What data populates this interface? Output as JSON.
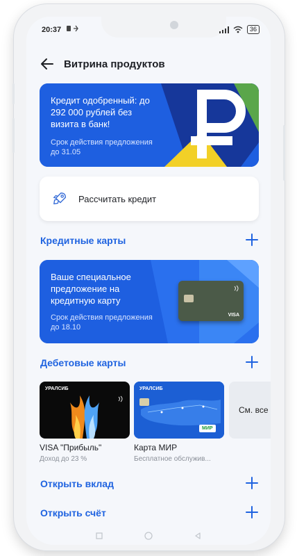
{
  "status_bar": {
    "time": "20:37",
    "battery": "36"
  },
  "header": {
    "title": "Витрина продуктов"
  },
  "promo_credit": {
    "title": "Кредит одобренный: до 292 000 рублей без визита в банк!",
    "subtitle": "Срок действия предложения до 31.05"
  },
  "calc": {
    "label": "Рассчитать кредит"
  },
  "sections": {
    "credit_cards": "Кредитные карты",
    "debit_cards": "Дебетовые карты",
    "deposit": "Открыть вклад",
    "account": "Открыть счёт"
  },
  "promo_card": {
    "title": "Ваше специальное предложение на кредитную карту",
    "subtitle": "Срок действия предложения до 18.10"
  },
  "debit_cards": [
    {
      "name": "VISA \"Прибыль\"",
      "sub": "Доход до 23 %",
      "brand": "УРАЛСИБ"
    },
    {
      "name": "Карта МИР",
      "sub": "Бесплатное обслужив...",
      "brand": "УРАЛСИБ",
      "badge": "МИР"
    }
  ],
  "see_all": "См. все",
  "card_brand": "VISA",
  "colors": {
    "accent": "#1f63e0",
    "promo_blue": "#1e5fe0",
    "promo_green": "#5aa64a",
    "promo_yellow": "#f2d027"
  }
}
